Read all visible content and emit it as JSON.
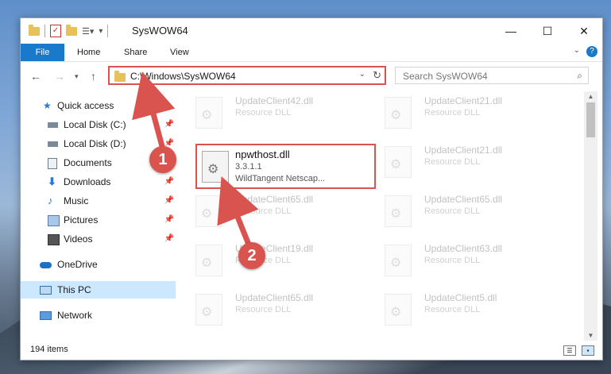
{
  "window": {
    "title": "SysWOW64",
    "controls": {
      "minimize": "—",
      "maximize": "☐",
      "close": "✕"
    }
  },
  "ribbon": {
    "file": "File",
    "tabs": [
      "Home",
      "Share",
      "View"
    ],
    "help": "?"
  },
  "navigation": {
    "address": "C:\\Windows\\SysWOW64",
    "search_placeholder": "Search SysWOW64"
  },
  "sidebar": {
    "items": [
      {
        "label": "Quick access",
        "icon": "star-icon",
        "pinned": false
      },
      {
        "label": "Local Disk (C:)",
        "icon": "drive-icon",
        "pinned": true
      },
      {
        "label": "Local Disk (D:)",
        "icon": "drive-icon",
        "pinned": true
      },
      {
        "label": "Documents",
        "icon": "documents-icon",
        "pinned": true
      },
      {
        "label": "Downloads",
        "icon": "download-icon",
        "pinned": true
      },
      {
        "label": "Music",
        "icon": "music-icon",
        "pinned": true
      },
      {
        "label": "Pictures",
        "icon": "pictures-icon",
        "pinned": true
      },
      {
        "label": "Videos",
        "icon": "videos-icon",
        "pinned": true
      },
      {
        "label": "OneDrive",
        "icon": "cloud-icon",
        "pinned": false
      },
      {
        "label": "This PC",
        "icon": "computer-icon",
        "pinned": false,
        "selected": true
      },
      {
        "label": "Network",
        "icon": "network-icon",
        "pinned": false
      }
    ]
  },
  "files": {
    "background_tiles": [
      {
        "name": "UpdateClient42.dll",
        "type": "Resource DLL"
      },
      {
        "name": "UpdateClient21.dll",
        "type": "Resource DLL"
      },
      {
        "name": "UpdateClient21.dll",
        "type": "Resource DLL"
      },
      {
        "name": "UpdateClient65.dll",
        "type": "Resource DLL"
      },
      {
        "name": "UpdateClient65.dll",
        "type": "Resource DLL"
      },
      {
        "name": "UpdateClient19.dll",
        "type": "Resource DLL"
      },
      {
        "name": "UpdateClient63.dll",
        "type": "Resource DLL"
      },
      {
        "name": "UpdateClient65.dll",
        "type": "Resource DLL"
      },
      {
        "name": "UpdateClient5.dll",
        "type": "Resource DLL"
      }
    ],
    "highlighted": {
      "name": "npwthost.dll",
      "version": "3.3.1.1",
      "description": "WildTangent Netscap..."
    }
  },
  "status": {
    "count": "194 items"
  },
  "annotations": {
    "badge1": "1",
    "badge2": "2",
    "color": "#d9534f"
  }
}
